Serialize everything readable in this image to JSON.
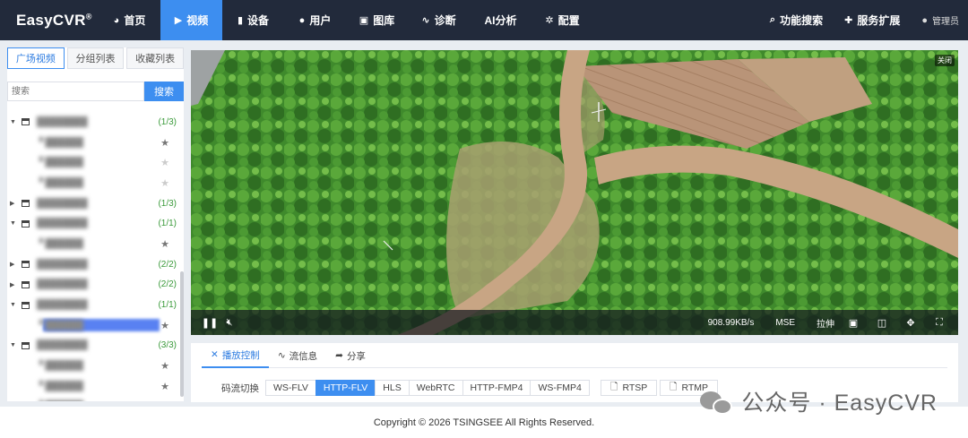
{
  "brand": {
    "name": "EasyCVR",
    "mark": "®"
  },
  "nav": {
    "items": [
      {
        "label": "首页",
        "icon": "dashboard-icon",
        "glyph": "◕"
      },
      {
        "label": "视频",
        "icon": "play-icon",
        "glyph": "▶"
      },
      {
        "label": "设备",
        "icon": "device-icon",
        "glyph": "▮"
      },
      {
        "label": "用户",
        "icon": "user-icon",
        "glyph": "●"
      },
      {
        "label": "图库",
        "icon": "gallery-icon",
        "glyph": "▣"
      },
      {
        "label": "诊断",
        "icon": "pulse-icon",
        "glyph": "∿"
      },
      {
        "label": "AI分析",
        "icon": "",
        "glyph": ""
      },
      {
        "label": "配置",
        "icon": "gear-icon",
        "glyph": "✲"
      }
    ],
    "active_index": 1,
    "right": [
      {
        "label": "功能搜索",
        "icon": "search-icon",
        "glyph": "⌕"
      },
      {
        "label": "服务扩展",
        "icon": "puzzle-icon",
        "glyph": "✚"
      }
    ],
    "user": "管理员"
  },
  "sidebar": {
    "tabs": [
      "广场视频",
      "分组列表",
      "收藏列表"
    ],
    "active_tab": 0,
    "search_placeholder": "搜索",
    "search_button": "搜索",
    "tree": [
      {
        "kind": "group",
        "expanded": true,
        "count": "(1/3)"
      },
      {
        "kind": "channel",
        "starred": true
      },
      {
        "kind": "channel",
        "starred": false
      },
      {
        "kind": "channel",
        "starred": false
      },
      {
        "kind": "group",
        "expanded": false,
        "count": "(1/3)"
      },
      {
        "kind": "group",
        "expanded": true,
        "count": "(1/1)"
      },
      {
        "kind": "channel",
        "starred": true
      },
      {
        "kind": "group",
        "expanded": false,
        "count": "(2/2)"
      },
      {
        "kind": "group",
        "expanded": false,
        "count": "(2/2)"
      },
      {
        "kind": "group",
        "expanded": true,
        "count": "(1/1)"
      },
      {
        "kind": "channel",
        "starred": true,
        "selected": true
      },
      {
        "kind": "group",
        "expanded": true,
        "count": "(3/3)"
      },
      {
        "kind": "channel",
        "starred": true
      },
      {
        "kind": "channel",
        "starred": true
      },
      {
        "kind": "channel",
        "starred": true
      }
    ]
  },
  "player": {
    "close_label": "关闭",
    "bitrate": "908.99KB/s",
    "mode": "MSE",
    "stretch": "拉伸"
  },
  "panel": {
    "tabs": [
      {
        "label": "播放控制",
        "icon": "tools-icon",
        "glyph": "✕"
      },
      {
        "label": "流信息",
        "icon": "pulse-icon",
        "glyph": "∿"
      },
      {
        "label": "分享",
        "icon": "share-icon",
        "glyph": "➦"
      }
    ],
    "active_tab": 0,
    "stream_label": "码流切换",
    "streams": [
      "WS-FLV",
      "HTTP-FLV",
      "HLS",
      "WebRTC",
      "HTTP-FMP4",
      "WS-FMP4"
    ],
    "active_stream": 1,
    "protocols": [
      "RTSP",
      "RTMP"
    ]
  },
  "footer": {
    "copyright": "Copyright © 2026 TSINGSEE All Rights Reserved."
  },
  "watermark": {
    "text": "公众号 · EasyCVR"
  },
  "colors": {
    "primary": "#3d8ef0",
    "navbar": "#222a3b",
    "count_green": "#3a9a3a"
  }
}
